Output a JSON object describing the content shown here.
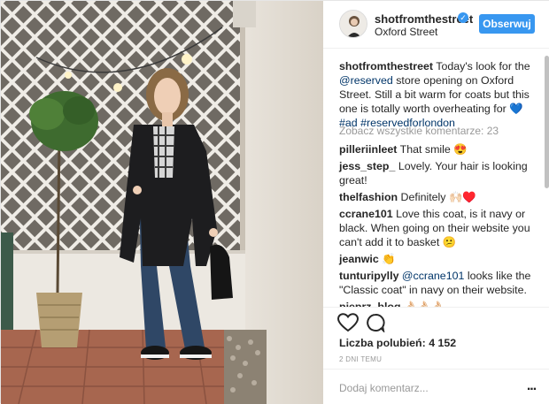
{
  "header": {
    "username": "shotfromthestreet",
    "verified_icon": "verified-badge-icon",
    "location": "Oxford Street",
    "follow_label": "Obserwuj"
  },
  "caption": {
    "username": "shotfromthestreet",
    "text_1": " Today's look for the ",
    "mention": "@reserved",
    "text_2": " store opening on Oxford Street. Still a bit warm for coats but this one is totally worth overheating for ",
    "emoji": "💙",
    "hashtag_1": "#ad",
    "hashtag_2": "#reservedforlondon"
  },
  "view_all_comments": "Zobacz wszystkie komentarze: 23",
  "comments": [
    {
      "user": "pilleriinleet",
      "text": " That smile 😍"
    },
    {
      "user": "jess_step_",
      "text": " Lovely. Your hair is looking great!"
    },
    {
      "user": "thelfashion",
      "text": " Definitely 🙌🏻♥️"
    },
    {
      "user": "ccrane101",
      "text": " Love this coat, is it navy or black. When going on their website you can't add it to basket 😕"
    },
    {
      "user": "jeanwic",
      "text": " 👏"
    },
    {
      "user": "tunturipylly",
      "mention": "@ccrane101",
      "text": " looks like the \"Classic coat\" in navy on their website."
    },
    {
      "user": "pieprz_blog",
      "text": " 👌🏻👌🏻👌🏻"
    }
  ],
  "actions": {
    "like_icon": "heart-outline-icon",
    "comment_icon": "comment-bubble-icon"
  },
  "likes": "Liczba polubień: 4 152",
  "timestamp": "2 DNI TEMU",
  "add_comment": {
    "placeholder": "Dodaj komentarz...",
    "more_icon": "more-options-icon",
    "more_glyph": "..."
  }
}
